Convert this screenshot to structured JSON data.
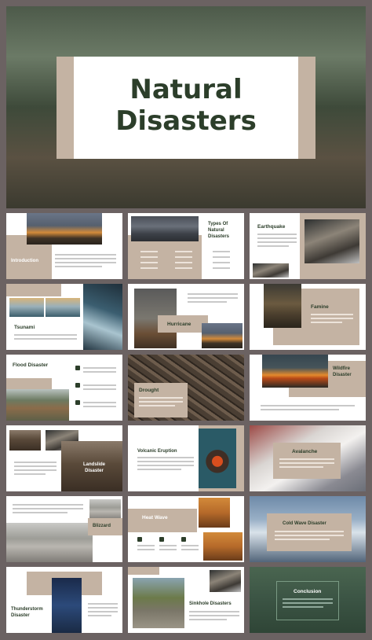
{
  "cover": {
    "title_line1": "Natural",
    "title_line2": "Disasters"
  },
  "slides": {
    "introduction": "Introduction",
    "types": "Types Of Natural Disasters",
    "earthquake": "Earthquake",
    "tsunami": "Tsunami",
    "hurricane": "Hurricane",
    "famine": "Famine",
    "flood": "Flood Disaster",
    "drought": "Drought",
    "wildfire": "Wildfire Disaster",
    "landslide": "Landslide Disaster",
    "volcanic": "Volcanic Eruption",
    "avalanche": "Avalanche",
    "blizzard": "Blizzard",
    "heatwave": "Heat Wave",
    "coldwave": "Cold Wave Disaster",
    "thunderstorm": "Thunderstorm Disaster",
    "sinkhole": "Sinkhole Disasters",
    "conclusion": "Conclusion"
  },
  "colors": {
    "accent": "#c4b3a3",
    "title_green": "#2c3e2a",
    "background": "#6b6262"
  }
}
